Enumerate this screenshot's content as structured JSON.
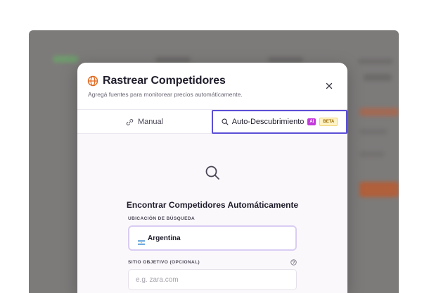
{
  "modal": {
    "title": "Rastrear Competidores",
    "subtitle": "Agregá fuentes para monitorear precios automáticamente.",
    "close_icon": "close-icon",
    "title_icon": "globe-icon"
  },
  "tabs": {
    "manual_label": "Manual",
    "manual_icon": "link-icon",
    "auto_label": "Auto-Descubrimiento",
    "auto_icon": "search-icon",
    "ai_badge": "AI",
    "beta_badge": "BETA"
  },
  "auto_discovery": {
    "heading": "Encontrar Competidores Automáticamente",
    "location_label": "UBICACIÓN DE BÚSQUEDA",
    "location_value": "Argentina",
    "location_flag": "argentina-flag-icon",
    "site_label": "SITIO OBJETIVO (OPCIONAL)",
    "site_placeholder": "e.g. zara.com",
    "site_value": ""
  },
  "colors": {
    "accent": "#5b4fd6",
    "title_icon": "#e0661a",
    "ai_badge": "#c23adb",
    "beta_badge_bg": "#fff3c4",
    "overlay": "#7d7b7a"
  }
}
